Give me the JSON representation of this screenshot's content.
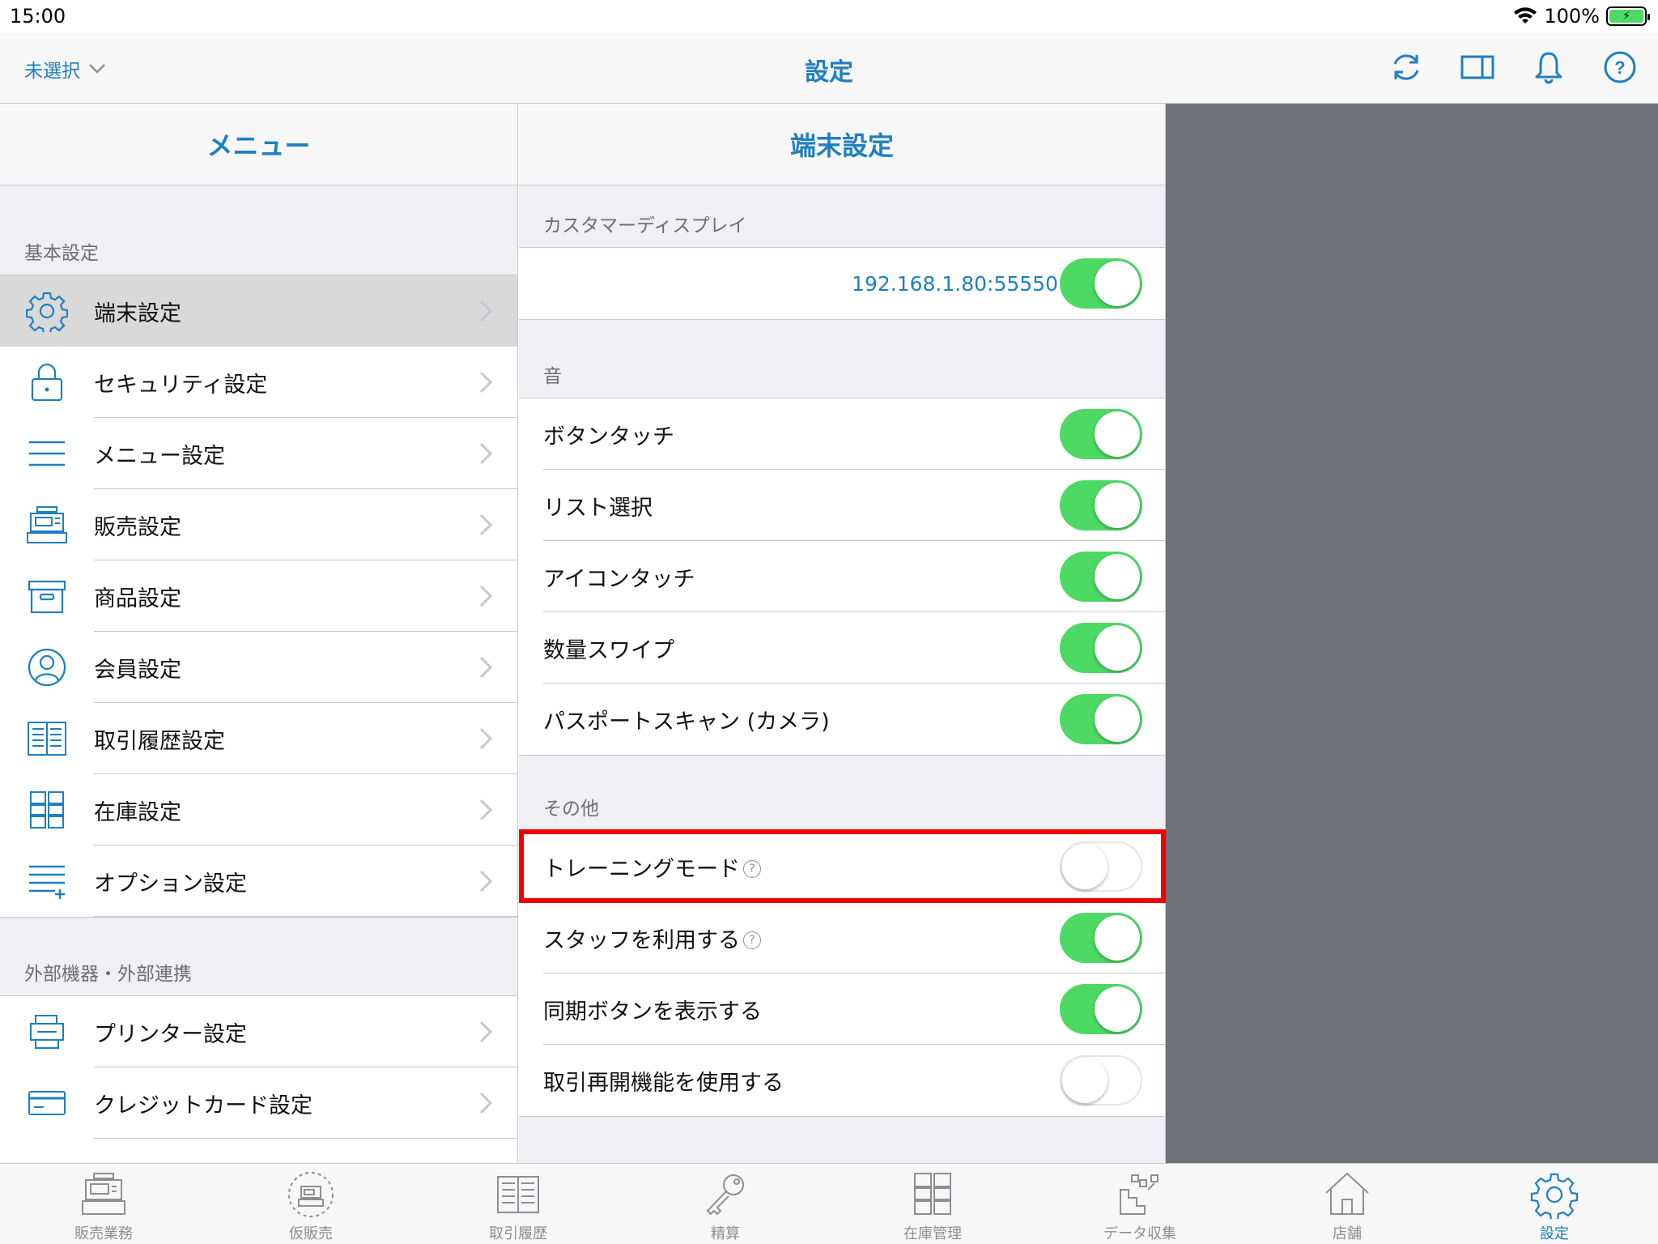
{
  "status_bar": {
    "time": "15:00",
    "battery": "100%"
  },
  "nav": {
    "store_selector": "未選択",
    "title": "設定"
  },
  "menu": {
    "header": "メニュー",
    "sections": [
      {
        "label": "基本設定",
        "items": [
          {
            "label": "端末設定",
            "icon": "gear-icon",
            "selected": true
          },
          {
            "label": "セキュリティ設定",
            "icon": "lock-icon"
          },
          {
            "label": "メニュー設定",
            "icon": "menu-lines-icon"
          },
          {
            "label": "販売設定",
            "icon": "register-icon"
          },
          {
            "label": "商品設定",
            "icon": "box-icon"
          },
          {
            "label": "会員設定",
            "icon": "person-icon"
          },
          {
            "label": "取引履歴設定",
            "icon": "book-icon"
          },
          {
            "label": "在庫設定",
            "icon": "shelves-icon"
          },
          {
            "label": "オプション設定",
            "icon": "list-plus-icon"
          }
        ]
      },
      {
        "label": "外部機器・外部連携",
        "items": [
          {
            "label": "プリンター設定",
            "icon": "printer-icon"
          },
          {
            "label": "クレジットカード設定",
            "icon": "credit-card-icon"
          }
        ]
      }
    ]
  },
  "detail": {
    "header": "端末設定",
    "customer_display": {
      "label": "カスタマーディスプレイ",
      "ip": "192.168.1.80:55550",
      "enabled": true
    },
    "sound": {
      "label": "音",
      "rows": [
        {
          "label": "ボタンタッチ",
          "on": true
        },
        {
          "label": "リスト選択",
          "on": true
        },
        {
          "label": "アイコンタッチ",
          "on": true
        },
        {
          "label": "数量スワイプ",
          "on": true
        },
        {
          "label": "パスポートスキャン (カメラ)",
          "on": true
        }
      ]
    },
    "other": {
      "label": "その他",
      "rows": [
        {
          "label": "トレーニングモード",
          "on": false,
          "help": true,
          "highlighted": true
        },
        {
          "label": "スタッフを利用する",
          "on": true,
          "help": true
        },
        {
          "label": "同期ボタンを表示する",
          "on": true
        },
        {
          "label": "取引再開機能を使用する",
          "on": false
        }
      ]
    }
  },
  "tabs": [
    {
      "label": "販売業務",
      "icon": "register-icon"
    },
    {
      "label": "仮販売",
      "icon": "temp-register-icon"
    },
    {
      "label": "取引履歴",
      "icon": "book-icon"
    },
    {
      "label": "精算",
      "icon": "key-icon"
    },
    {
      "label": "在庫管理",
      "icon": "shelves-icon"
    },
    {
      "label": "データ収集",
      "icon": "data-collection-icon"
    },
    {
      "label": "店舗",
      "icon": "house-icon"
    },
    {
      "label": "設定",
      "icon": "gear-icon",
      "active": true
    }
  ],
  "colors": {
    "accent": "#1e7fc1",
    "toggle_on": "#4cd964",
    "highlight": "#f00000",
    "detail_bg": "#6e7178"
  }
}
